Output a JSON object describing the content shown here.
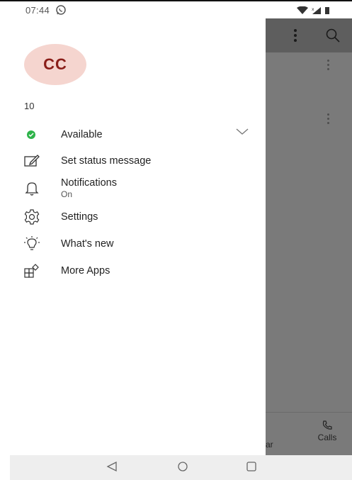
{
  "status_bar": {
    "time": "07:44",
    "notification_icon": "whatsapp-icon",
    "system_icons": [
      "wifi-icon",
      "signal-icon",
      "battery-icon"
    ]
  },
  "drawer": {
    "avatar_initials": "CC",
    "user_name": "10",
    "presence": {
      "label": "Available",
      "icon": "available-presence-icon",
      "color": "#2eb34a"
    },
    "items": [
      {
        "label": "Set status message",
        "icon": "edit-status-icon"
      },
      {
        "label": "Notifications",
        "sub": "On",
        "icon": "bell-icon"
      },
      {
        "label": "Settings",
        "icon": "gear-icon"
      },
      {
        "label": "What's new",
        "icon": "lightbulb-icon"
      },
      {
        "label": "More Apps",
        "icon": "apps-icon"
      }
    ]
  },
  "background_app": {
    "bottom_nav": {
      "partial_label": "ar",
      "calls_label": "Calls"
    }
  },
  "colors": {
    "avatar_bg": "#f5d5cf",
    "avatar_text": "#8a1e19",
    "overlay": "#7a7a7a"
  },
  "nav_bar": [
    "back-icon",
    "home-icon",
    "recents-icon"
  ]
}
